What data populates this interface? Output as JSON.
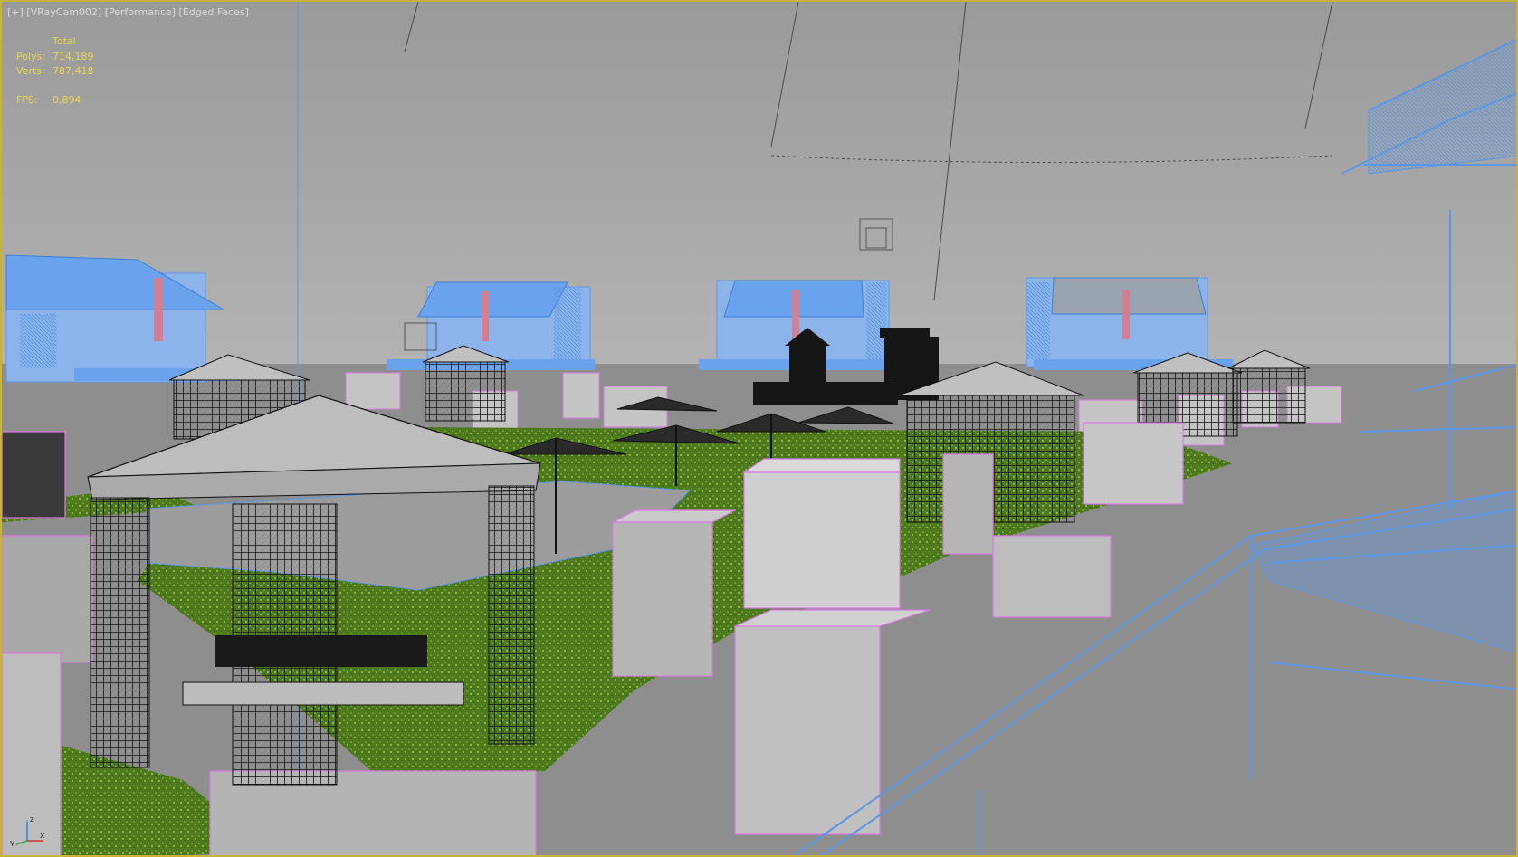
{
  "viewport": {
    "menu": {
      "plus": "[+]",
      "camera": "[VRayCam002]",
      "shading_mode": "[Performance]",
      "edged": "[Edged Faces]"
    },
    "stats": {
      "header": "Total",
      "polys_label": "Polys:",
      "polys_value": "714,189",
      "verts_label": "Verts:",
      "verts_value": "787,418",
      "fps_label": "FPS:",
      "fps_value": "0,894"
    },
    "axis": {
      "z": "z",
      "x": "x",
      "y": "y"
    }
  },
  "colors": {
    "sky": "#a3a3a3",
    "ground": "#8e8e8e",
    "grass": "#4e7a1e",
    "selected_wire": "#5b97e6",
    "object_edge": "#d67be0",
    "block_face": "#b8b8b8",
    "gazebo_dark": "#1e1e1e",
    "stat_text": "#e8d64a",
    "menu_text": "#d9d9d9",
    "border": "#c8b23a"
  }
}
